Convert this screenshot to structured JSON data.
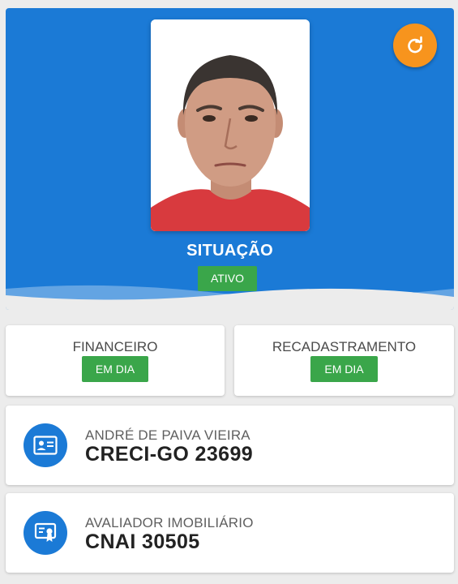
{
  "header": {
    "photo_alt": "",
    "situacao_title": "SITUAÇÃO",
    "situacao_value": "ATIVO",
    "refresh_icon": "refresh-icon",
    "colors": {
      "primary": "#1b7ad6",
      "accent": "#f7941d",
      "success": "#3aa64a"
    }
  },
  "status_cards": [
    {
      "label": "FINANCEIRO",
      "value": "EM DIA"
    },
    {
      "label": "RECADASTRAMENTO",
      "value": "EM DIA"
    }
  ],
  "info_cards": [
    {
      "icon": "id-card-icon",
      "line1": "ANDRÉ DE PAIVA VIEIRA",
      "line2": "CRECI-GO 23699"
    },
    {
      "icon": "certificate-icon",
      "line1": "AVALIADOR IMOBILIÁRIO",
      "line2": "CNAI 30505"
    }
  ]
}
